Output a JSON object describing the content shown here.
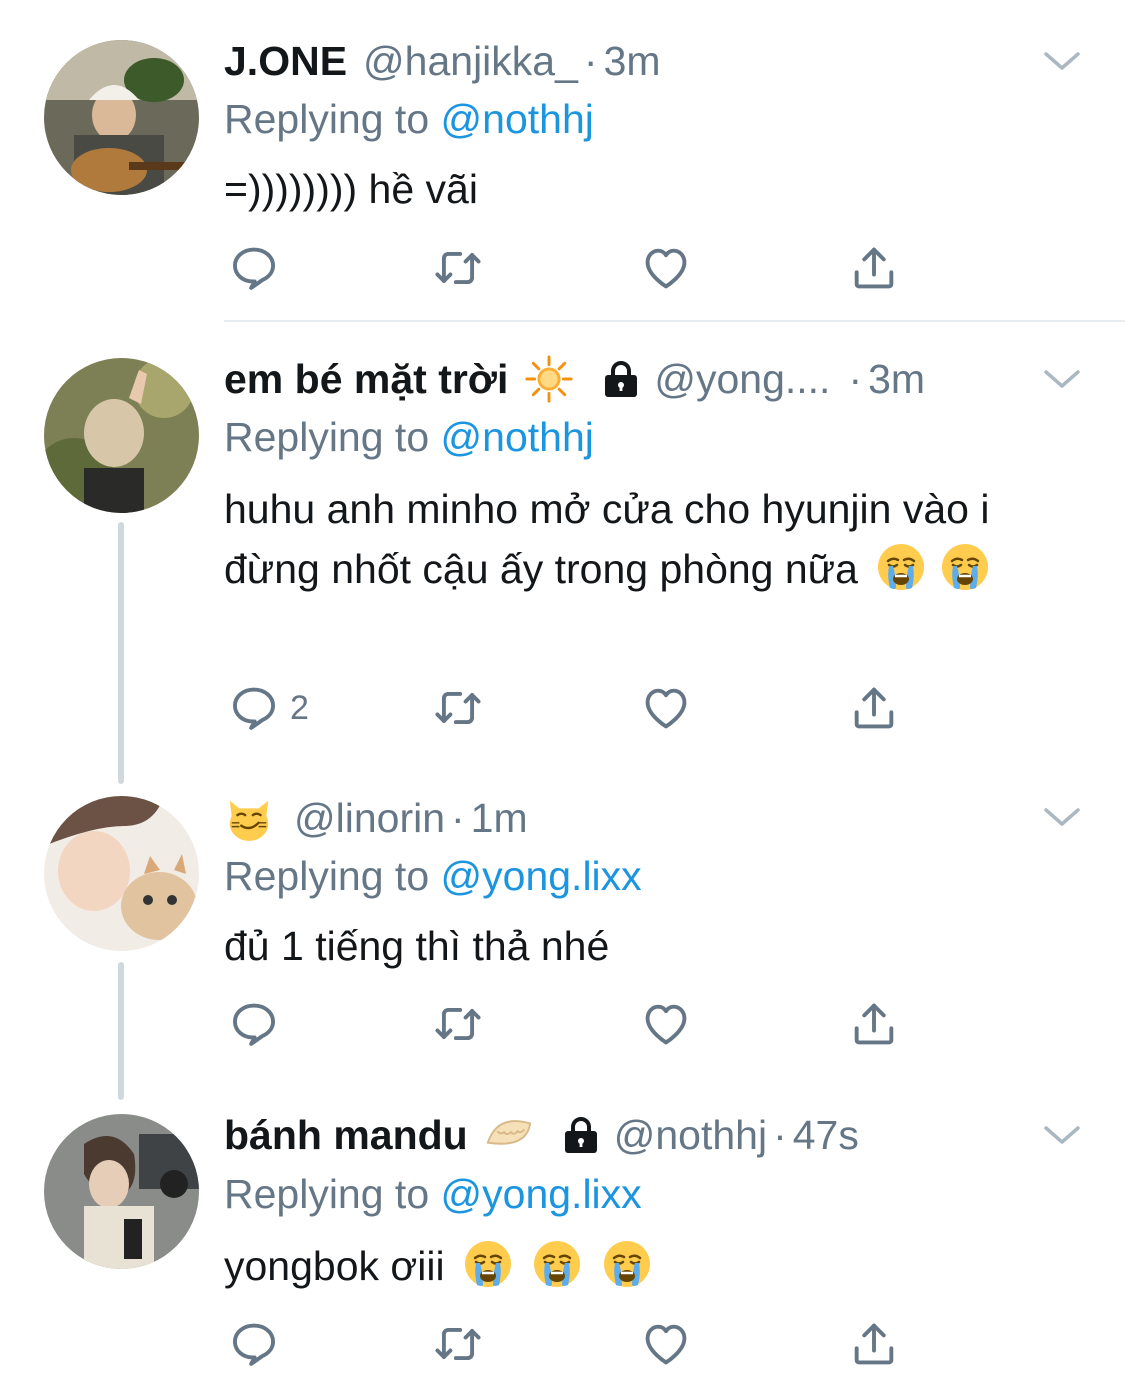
{
  "colors": {
    "text": "#14171a",
    "muted": "#657786",
    "link": "#1b95e0",
    "thread_line": "#cfd9de"
  },
  "tweets": [
    {
      "name": "J.ONE",
      "handle": "@hanjikka_",
      "dot": "·",
      "time": "3m",
      "replying_prefix": "Replying to",
      "replying_to": "@nothhj",
      "text": "=)))))))) hề vãi",
      "reply_count": ""
    },
    {
      "name": "em bé mặt trời",
      "name_emoji": "sun-emoji",
      "locked": true,
      "handle": "@yong....",
      "dot": "·",
      "time": "3m",
      "replying_prefix": "Replying to",
      "replying_to": "@nothhj",
      "text": "huhu anh minho mở cửa cho hyunjin vào i đừng nhốt cậu ấy trong phòng nữa",
      "text_emojis": [
        "crying-face-emoji",
        "crying-face-emoji"
      ],
      "reply_count": "2"
    },
    {
      "name_emoji": "smirking-cat-emoji",
      "handle": "@linorin",
      "dot": "·",
      "time": "1m",
      "replying_prefix": "Replying to",
      "replying_to": "@yong.lixx",
      "text": "đủ 1 tiếng thì thả nhé",
      "reply_count": ""
    },
    {
      "name": "bánh mandu",
      "name_emoji": "dumpling-emoji",
      "locked": true,
      "handle": "@nothhj",
      "dot": "·",
      "time": "47s",
      "replying_prefix": "Replying to",
      "replying_to": "@yong.lixx",
      "text": "yongbok ơiii",
      "text_emojis": [
        "crying-face-emoji",
        "crying-face-emoji",
        "crying-face-emoji"
      ],
      "reply_count": ""
    }
  ]
}
